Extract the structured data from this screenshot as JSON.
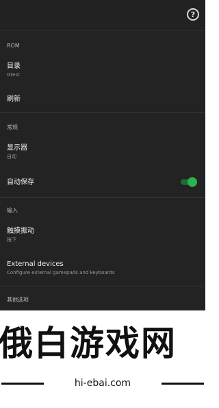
{
  "topbar": {
    "help_icon": "help-circle-icon",
    "help_glyph": "?"
  },
  "sections": {
    "rom": {
      "header": "ROM",
      "directory": {
        "title": "目录",
        "subtitle": "Gtest"
      },
      "refresh": {
        "title": "刷新"
      }
    },
    "general": {
      "header": "常规",
      "display": {
        "title": "显示器",
        "subtitle": "自动"
      },
      "autosave": {
        "title": "自动保存",
        "enabled": true
      }
    },
    "input": {
      "header": "输入",
      "haptic": {
        "title": "触摸振动",
        "subtitle": "按下"
      },
      "external": {
        "title": "External devices",
        "subtitle": "Configure external gamepads and keyboards"
      }
    },
    "other": {
      "header": "其他选项"
    }
  },
  "colors": {
    "background": "#232323",
    "toggle_on": "#2bb24c"
  },
  "watermark": {
    "title": "俄白游戏网",
    "url": "hi-ebai.com"
  }
}
